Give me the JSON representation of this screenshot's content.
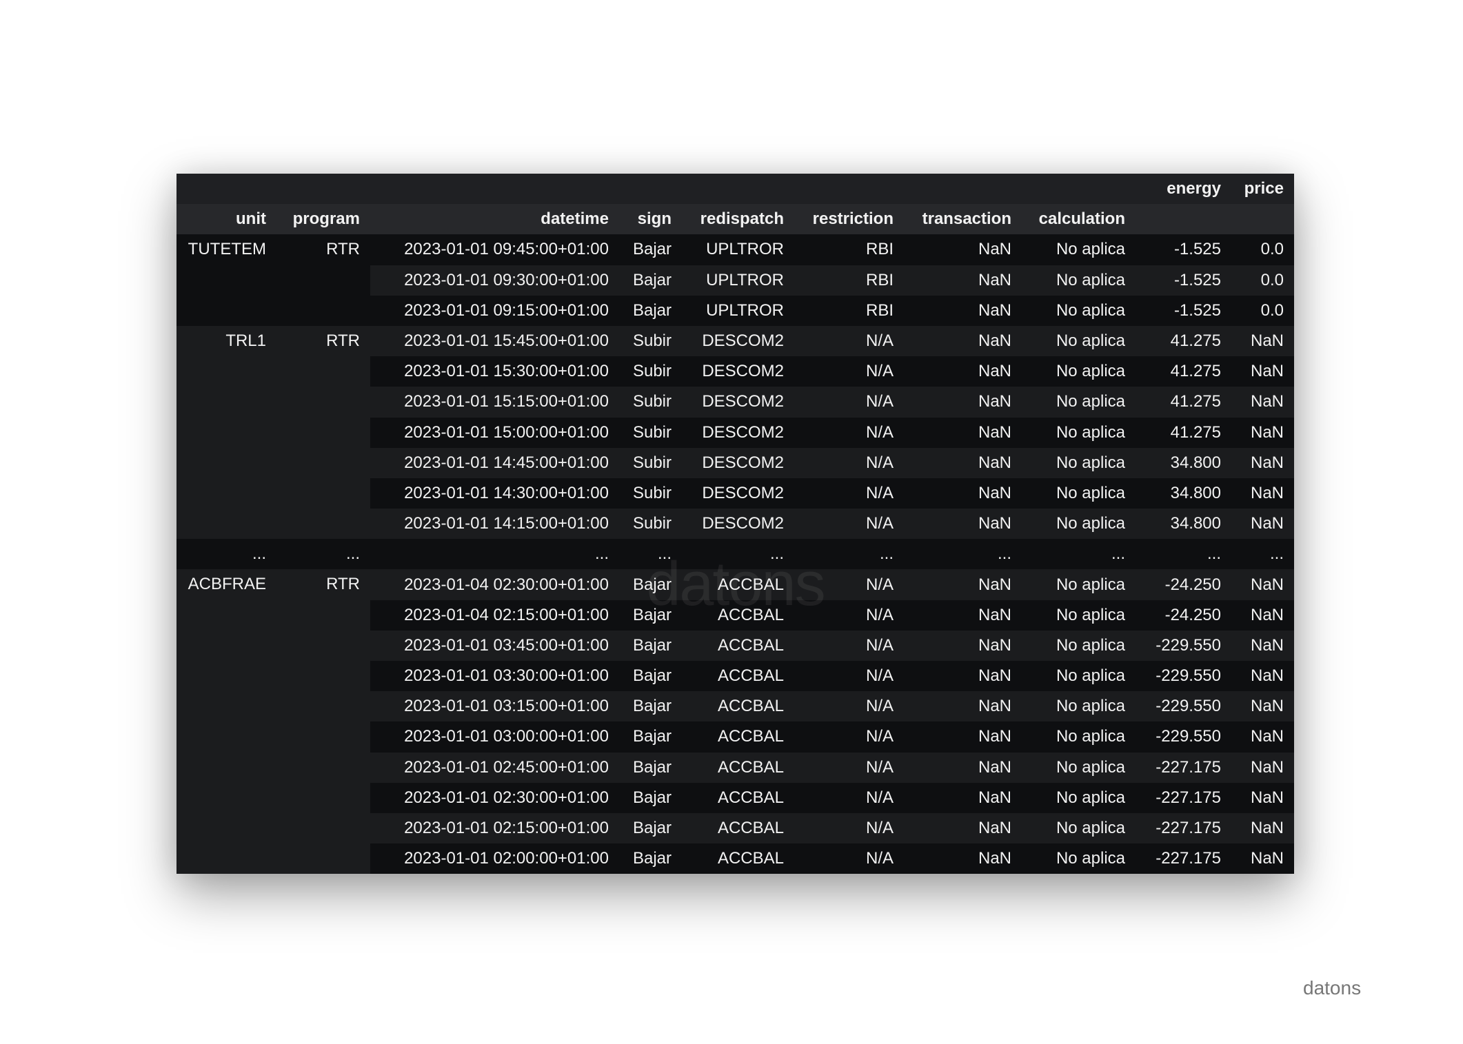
{
  "header": {
    "columns_top": [
      "",
      "",
      "",
      "",
      "",
      "",
      "",
      "",
      "energy",
      "price"
    ],
    "columns": [
      "unit",
      "program",
      "datetime",
      "sign",
      "redispatch",
      "restriction",
      "transaction",
      "calculation",
      "",
      ""
    ]
  },
  "groups": [
    {
      "unit": "TUTETEM",
      "program": "RTR",
      "rows": [
        [
          "2023-01-01 09:45:00+01:00",
          "Bajar",
          "UPLTROR",
          "RBI",
          "NaN",
          "No aplica",
          "-1.525",
          "0.0"
        ],
        [
          "2023-01-01 09:30:00+01:00",
          "Bajar",
          "UPLTROR",
          "RBI",
          "NaN",
          "No aplica",
          "-1.525",
          "0.0"
        ],
        [
          "2023-01-01 09:15:00+01:00",
          "Bajar",
          "UPLTROR",
          "RBI",
          "NaN",
          "No aplica",
          "-1.525",
          "0.0"
        ]
      ]
    },
    {
      "unit": "TRL1",
      "program": "RTR",
      "rows": [
        [
          "2023-01-01 15:45:00+01:00",
          "Subir",
          "DESCOM2",
          "N/A",
          "NaN",
          "No aplica",
          "41.275",
          "NaN"
        ],
        [
          "2023-01-01 15:30:00+01:00",
          "Subir",
          "DESCOM2",
          "N/A",
          "NaN",
          "No aplica",
          "41.275",
          "NaN"
        ],
        [
          "2023-01-01 15:15:00+01:00",
          "Subir",
          "DESCOM2",
          "N/A",
          "NaN",
          "No aplica",
          "41.275",
          "NaN"
        ],
        [
          "2023-01-01 15:00:00+01:00",
          "Subir",
          "DESCOM2",
          "N/A",
          "NaN",
          "No aplica",
          "41.275",
          "NaN"
        ],
        [
          "2023-01-01 14:45:00+01:00",
          "Subir",
          "DESCOM2",
          "N/A",
          "NaN",
          "No aplica",
          "34.800",
          "NaN"
        ],
        [
          "2023-01-01 14:30:00+01:00",
          "Subir",
          "DESCOM2",
          "N/A",
          "NaN",
          "No aplica",
          "34.800",
          "NaN"
        ],
        [
          "2023-01-01 14:15:00+01:00",
          "Subir",
          "DESCOM2",
          "N/A",
          "NaN",
          "No aplica",
          "34.800",
          "NaN"
        ]
      ]
    },
    {
      "unit": "...",
      "program": "...",
      "rows": [
        [
          "...",
          "...",
          "...",
          "...",
          "...",
          "...",
          "...",
          "..."
        ]
      ]
    },
    {
      "unit": "ACBFRAE",
      "program": "RTR",
      "rows": [
        [
          "2023-01-04 02:30:00+01:00",
          "Bajar",
          "ACCBAL",
          "N/A",
          "NaN",
          "No aplica",
          "-24.250",
          "NaN"
        ],
        [
          "2023-01-04 02:15:00+01:00",
          "Bajar",
          "ACCBAL",
          "N/A",
          "NaN",
          "No aplica",
          "-24.250",
          "NaN"
        ],
        [
          "2023-01-01 03:45:00+01:00",
          "Bajar",
          "ACCBAL",
          "N/A",
          "NaN",
          "No aplica",
          "-229.550",
          "NaN"
        ],
        [
          "2023-01-01 03:30:00+01:00",
          "Bajar",
          "ACCBAL",
          "N/A",
          "NaN",
          "No aplica",
          "-229.550",
          "NaN"
        ],
        [
          "2023-01-01 03:15:00+01:00",
          "Bajar",
          "ACCBAL",
          "N/A",
          "NaN",
          "No aplica",
          "-229.550",
          "NaN"
        ],
        [
          "2023-01-01 03:00:00+01:00",
          "Bajar",
          "ACCBAL",
          "N/A",
          "NaN",
          "No aplica",
          "-229.550",
          "NaN"
        ],
        [
          "2023-01-01 02:45:00+01:00",
          "Bajar",
          "ACCBAL",
          "N/A",
          "NaN",
          "No aplica",
          "-227.175",
          "NaN"
        ],
        [
          "2023-01-01 02:30:00+01:00",
          "Bajar",
          "ACCBAL",
          "N/A",
          "NaN",
          "No aplica",
          "-227.175",
          "NaN"
        ],
        [
          "2023-01-01 02:15:00+01:00",
          "Bajar",
          "ACCBAL",
          "N/A",
          "NaN",
          "No aplica",
          "-227.175",
          "NaN"
        ],
        [
          "2023-01-01 02:00:00+01:00",
          "Bajar",
          "ACCBAL",
          "N/A",
          "NaN",
          "No aplica",
          "-227.175",
          "NaN"
        ]
      ]
    }
  ],
  "watermark": "datons",
  "brand": "datons"
}
